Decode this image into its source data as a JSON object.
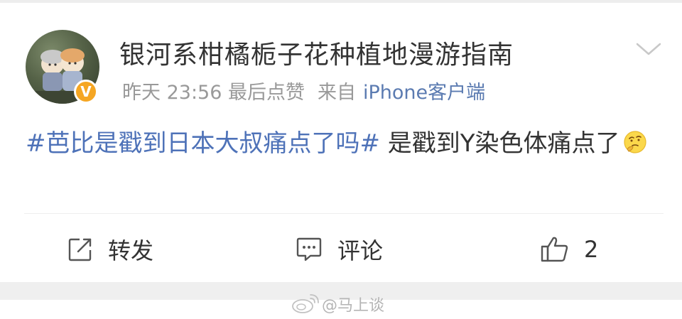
{
  "header": {
    "username": "银河系柑橘栀子花种植地漫游指南",
    "time": "昨天 23:56 最后点赞",
    "source_prefix": "来自",
    "source_client": "iPhone客户端",
    "verified_mark": "V",
    "verified_color": "#f5a623"
  },
  "post": {
    "hashtag": "#芭比是戳到日本大叔痛点了吗#",
    "text": " 是戳到Y染色体痛点了",
    "emoji": "thinking-face-icon"
  },
  "actions": {
    "repost_label": "转发",
    "comment_label": "评论",
    "like_count": "2"
  },
  "watermark": "@马上谈",
  "colors": {
    "link": "#4e72b8",
    "meta": "#999999",
    "text": "#333333"
  }
}
